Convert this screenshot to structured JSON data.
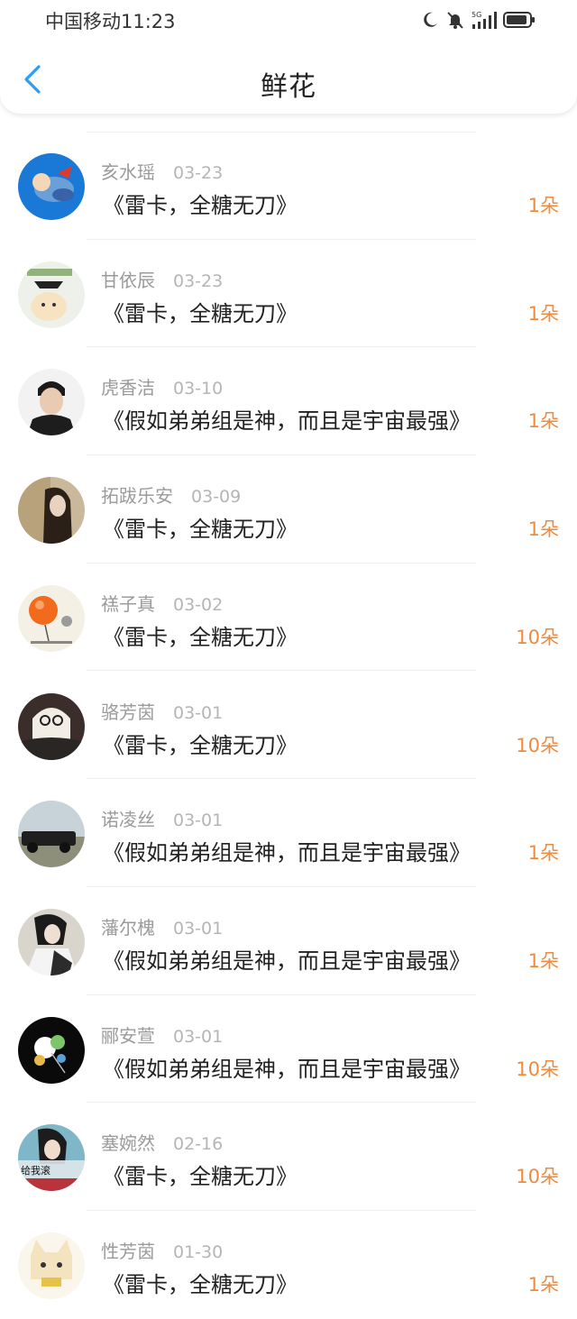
{
  "status_bar": {
    "carrier_time": "中国移动11:23",
    "icons": [
      "moon-icon",
      "mute-bell-icon",
      "signal-5g-icon",
      "battery-icon"
    ]
  },
  "navbar": {
    "back_icon": "chevron-left-icon",
    "title": "鲜花"
  },
  "colors": {
    "accent_blue": "#2a9df4",
    "count_orange": "#f08a3c",
    "meta_gray": "#9b9b9b"
  },
  "items": [
    {
      "name": "亥水瑶",
      "date": "03-23",
      "title": "《雷卡，全糖无刀》",
      "count": "1朵"
    },
    {
      "name": "甘依辰",
      "date": "03-23",
      "title": "《雷卡，全糖无刀》",
      "count": "1朵"
    },
    {
      "name": "虎香洁",
      "date": "03-10",
      "title": "《假如弟弟组是神，而且是宇宙最强》",
      "count": "1朵"
    },
    {
      "name": "拓跋乐安",
      "date": "03-09",
      "title": "《雷卡，全糖无刀》",
      "count": "1朵"
    },
    {
      "name": "禚子真",
      "date": "03-02",
      "title": "《雷卡，全糖无刀》",
      "count": "10朵"
    },
    {
      "name": "骆芳茵",
      "date": "03-01",
      "title": "《雷卡，全糖无刀》",
      "count": "10朵"
    },
    {
      "name": "诺凌丝",
      "date": "03-01",
      "title": "《假如弟弟组是神，而且是宇宙最强》",
      "count": "1朵"
    },
    {
      "name": "藩尔槐",
      "date": "03-01",
      "title": "《假如弟弟组是神，而且是宇宙最强》",
      "count": "1朵"
    },
    {
      "name": "郦安萱",
      "date": "03-01",
      "title": "《假如弟弟组是神，而且是宇宙最强》",
      "count": "10朵"
    },
    {
      "name": "塞婉然",
      "date": "02-16",
      "title": "《雷卡，全糖无刀》",
      "count": "10朵"
    },
    {
      "name": "性芳茵",
      "date": "01-30",
      "title": "《雷卡，全糖无刀》",
      "count": "1朵"
    }
  ],
  "avatar_labels": {
    "9": "给我滚"
  }
}
